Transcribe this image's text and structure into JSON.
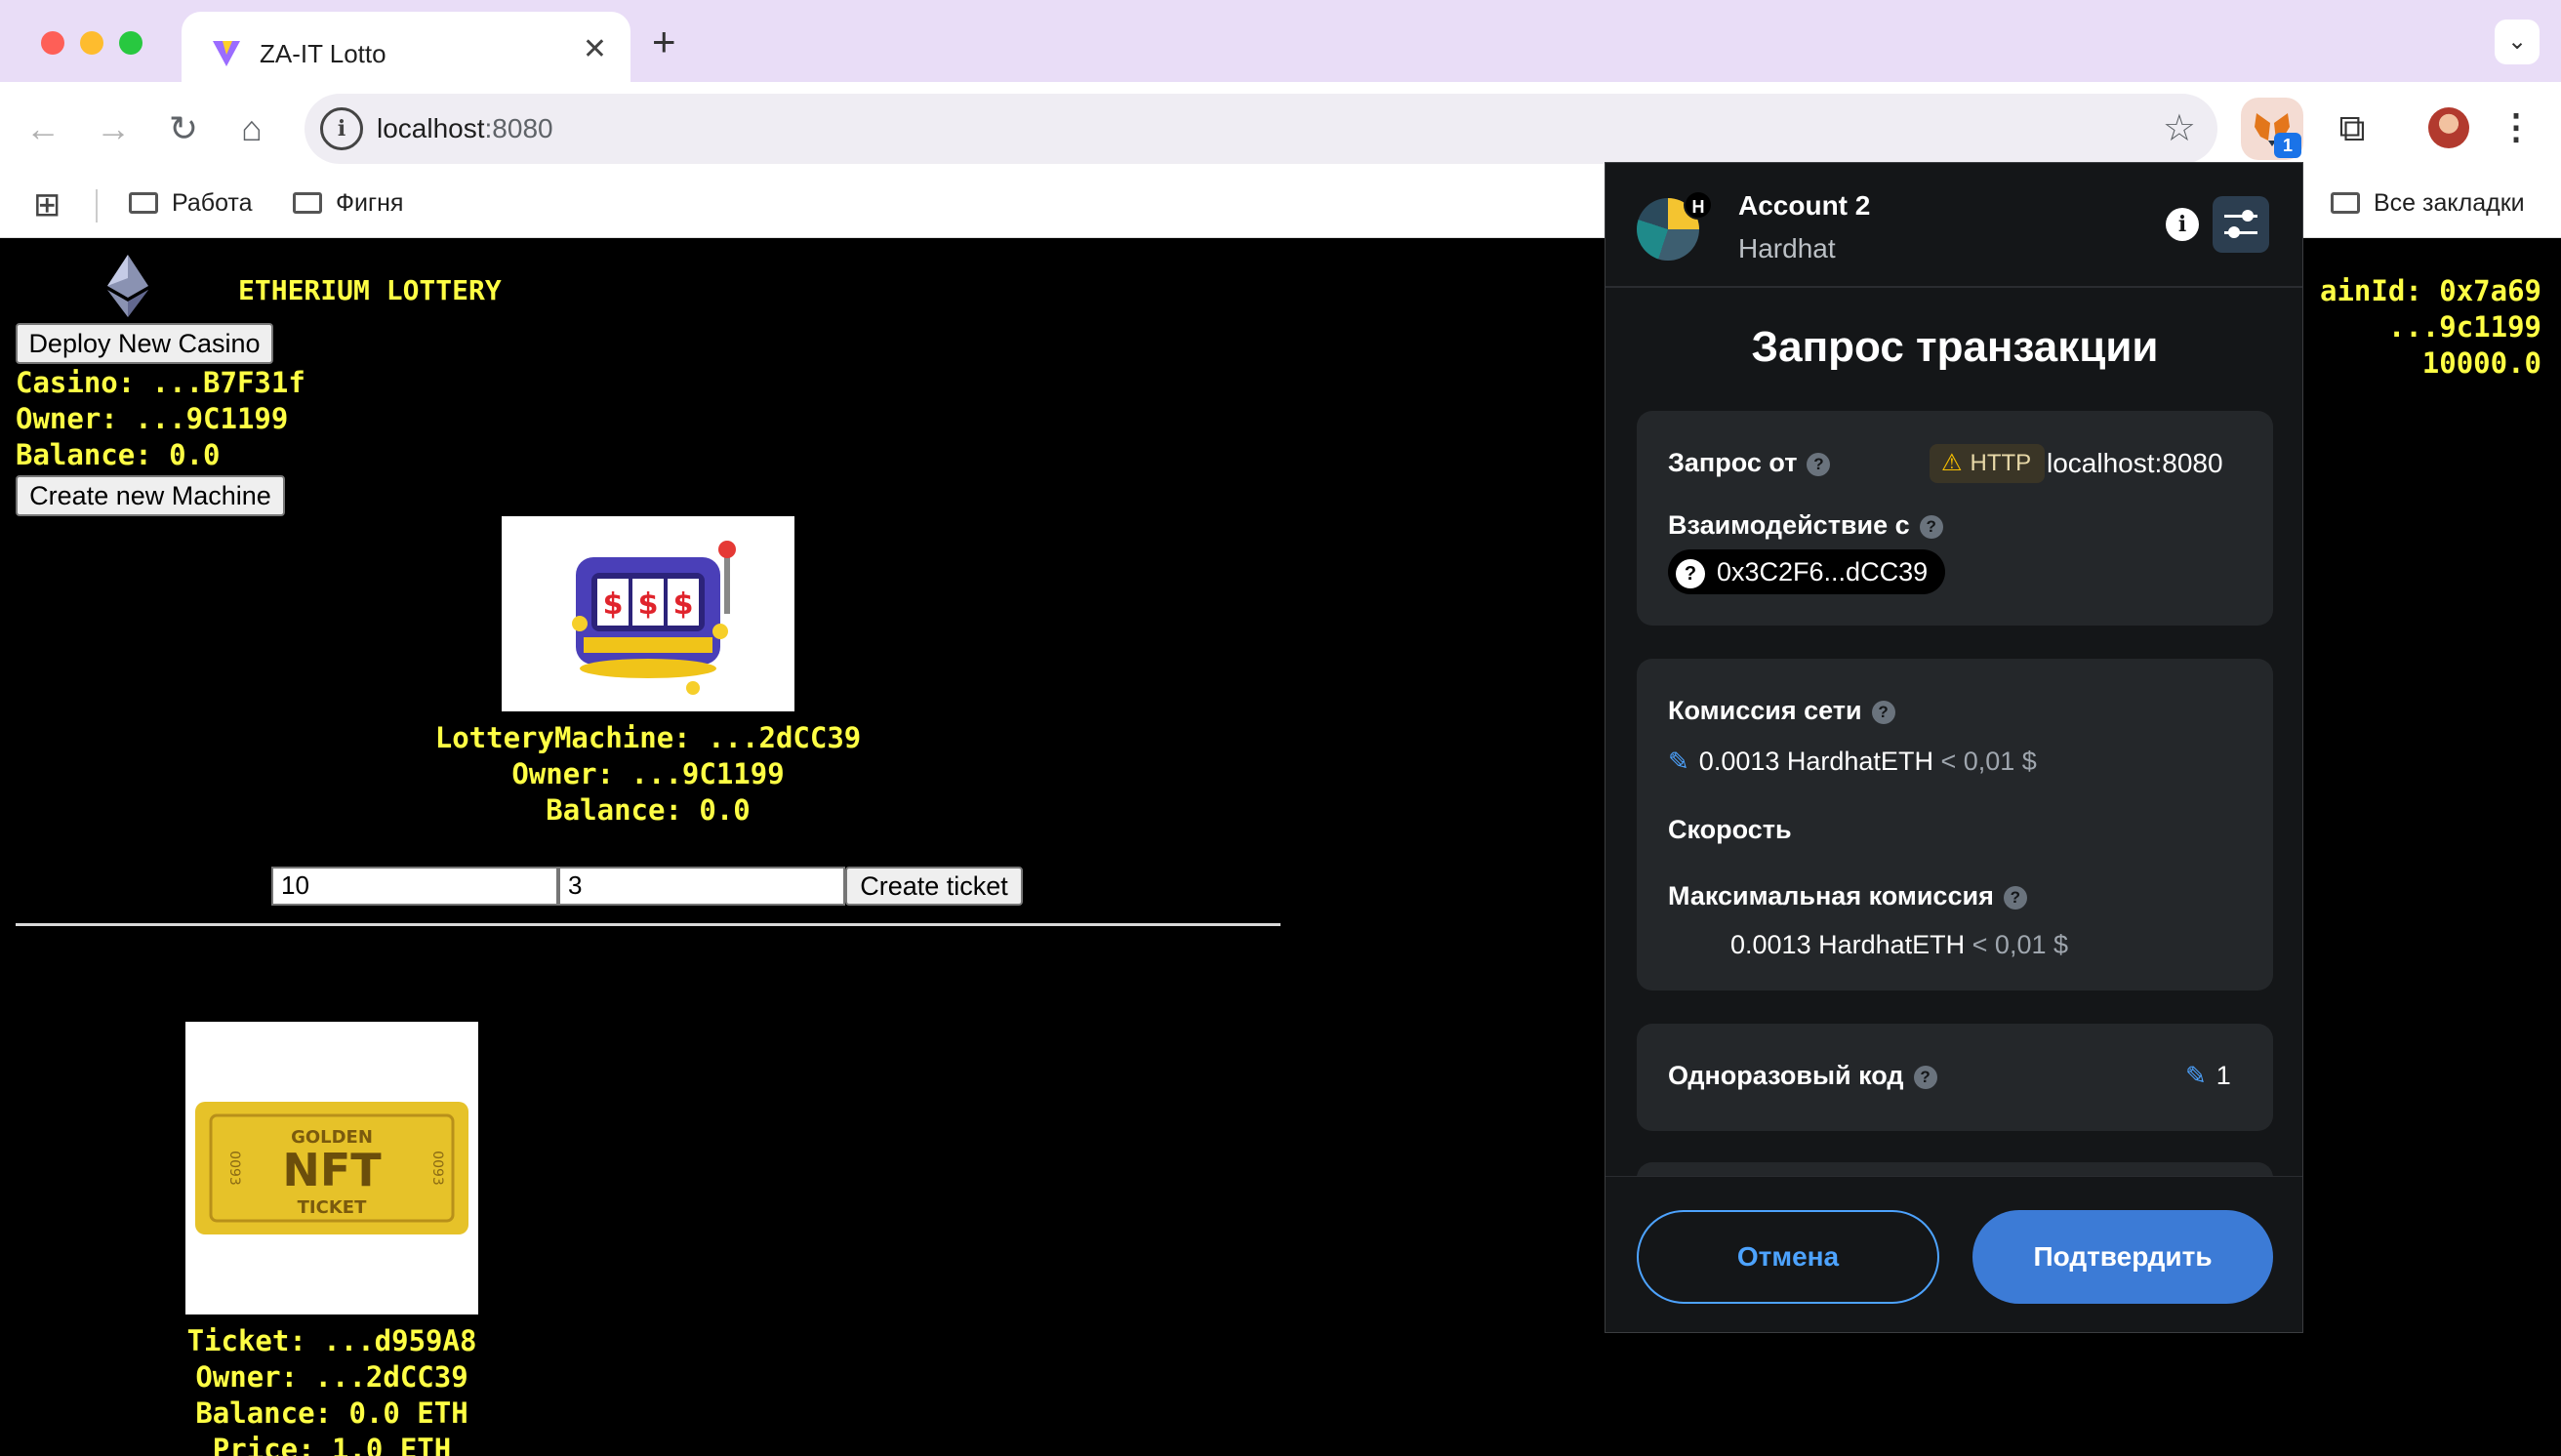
{
  "browser": {
    "tab_title": "ZA-IT Lotto",
    "tab_close": "✕",
    "new_tab": "+",
    "url_host": "localhost",
    "url_port": ":8080",
    "extension_badge": "1",
    "bookmarks": [
      {
        "label": "Работа"
      },
      {
        "label": "Фигня"
      }
    ],
    "all_bookmarks": "Все закладки",
    "accent": "#e9ddf7"
  },
  "page": {
    "title": "ETHERIUM LOTTERY",
    "deploy_button": "Deploy New Casino",
    "casino": "Casino: ...B7F31f",
    "owner": "Owner: ...9C1199",
    "balance": "Balance: 0.0",
    "create_machine_button": "Create new Machine",
    "machine": {
      "name": "LotteryMachine: ...2dCC39",
      "owner": "Owner: ...9C1199",
      "balance": "Balance: 0.0",
      "input1": "10",
      "input2": "3",
      "create_ticket_button": "Create ticket"
    },
    "ticket": {
      "id": "Ticket: ...d959A8",
      "owner": "Owner: ...2dCC39",
      "balance": "Balance: 0.0 ETH",
      "price": "Price: 1.0 ETH",
      "image_top": "GOLDEN",
      "image_main": "NFT",
      "image_bottom": "TICKET",
      "image_serial": "0093"
    },
    "right_info": {
      "chain": "ainId: 0x7a69",
      "account": "...9c1199",
      "balance": "10000.0"
    },
    "text_color": "#ffff44"
  },
  "metamask": {
    "account_name": "Account 2",
    "network": "Hardhat",
    "network_initial": "H",
    "title": "Запрос транзакции",
    "request_from_label": "Запрос от",
    "http_label": "HTTP",
    "origin": "localhost:8080",
    "interaction_label": "Взаимодействие с",
    "contract": "0x3C2F6...dCC39",
    "network_fee_label": "Комиссия сети",
    "network_fee_value": "0.0013 HardhatETH",
    "network_fee_fiat": "< 0,01 $",
    "speed_label": "Скорость",
    "max_fee_label": "Максимальная комиссия",
    "max_fee_value": "0.0013 HardhatETH",
    "max_fee_fiat": "< 0,01 $",
    "nonce_label": "Одноразовый код",
    "nonce_value": "1",
    "cancel_button": "Отмена",
    "confirm_button": "Подтвердить",
    "accent": "#4da3ff"
  }
}
